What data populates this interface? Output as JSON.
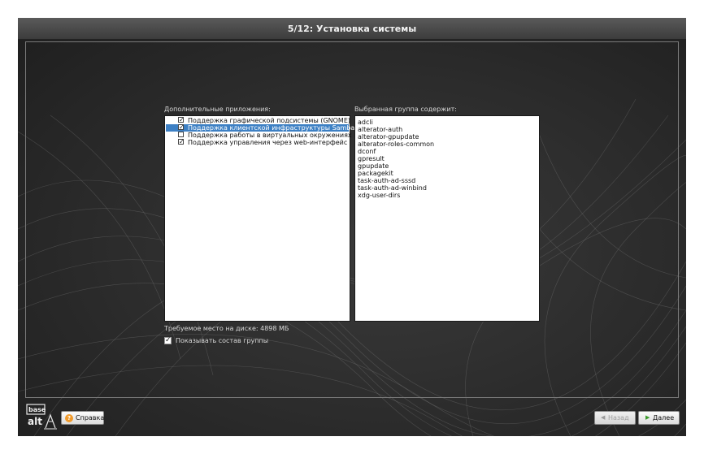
{
  "window": {
    "title": "5/12: Установка системы"
  },
  "apps": {
    "label": "Дополнительные приложения:",
    "items": [
      {
        "label": "Поддержка графической подсистемы (GNOME)",
        "checked": true,
        "selected": false
      },
      {
        "label": "Поддержка клиентской инфраструктуры Samba AD",
        "checked": true,
        "selected": true
      },
      {
        "label": "Поддержка работы в виртуальных окружениях",
        "checked": false,
        "selected": false
      },
      {
        "label": "Поддержка управления через web-интерфейс",
        "checked": true,
        "selected": false
      }
    ]
  },
  "group": {
    "label": "Выбранная группа содержит:",
    "packages": [
      "adcli",
      "alterator-auth",
      "alterator-gpupdate",
      "alterator-roles-common",
      "dconf",
      "gpresult",
      "gpupdate",
      "packagekit",
      "task-auth-ad-sssd",
      "task-auth-ad-winbind",
      "xdg-user-dirs"
    ]
  },
  "disk_space": "Требуемое место на диске: 4898 МБ",
  "show_group": {
    "label": "Показывать состав группы",
    "checked": true
  },
  "logo": {
    "text_top": "base",
    "text_bottom": "alt"
  },
  "footer": {
    "help_label": "Справка",
    "back_label": "Назад",
    "next_label": "Далее"
  },
  "colors": {
    "selection": "#3d80c4",
    "help_icon": "#f19a2a",
    "next_arrow": "#3a9a2a"
  }
}
